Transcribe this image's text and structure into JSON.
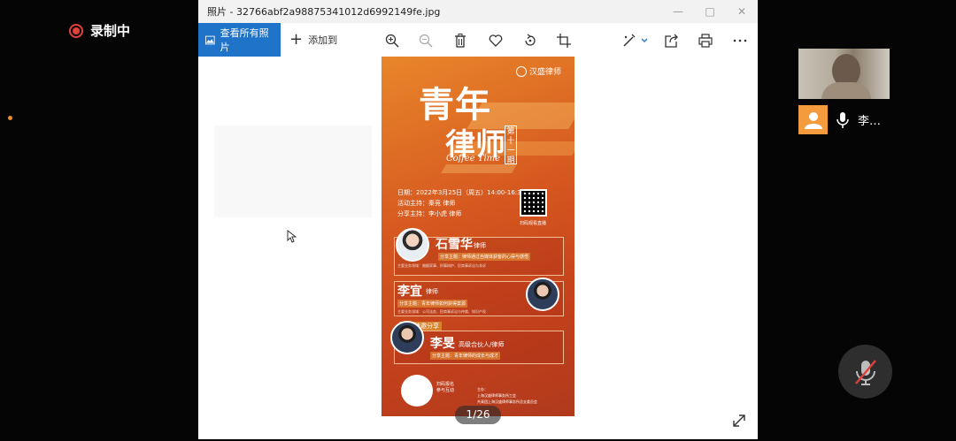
{
  "recording": {
    "label": "录制中",
    "color": "#e0413a"
  },
  "window": {
    "title": "照片 - 32766abf2a98875341012d6992149fe.jpg",
    "controls": [
      "minimize-icon",
      "maximize-icon",
      "close-icon"
    ]
  },
  "toolbar": {
    "view_all": "查看所有照片",
    "add_to": "添加到",
    "tools": [
      "zoom-in-icon",
      "zoom-out-icon",
      "delete-icon",
      "favorite-icon",
      "rotate-icon",
      "crop-icon",
      "edit-icon",
      "share-icon",
      "print-icon",
      "more-icon"
    ],
    "accent": "#1f74c9"
  },
  "poster": {
    "logo": "汉盛律师",
    "title_line1": "青年",
    "title_line2": "律师",
    "issue": "第十一期",
    "subtitle": "Coffee Time",
    "date": "日期：2022年3月25日（周五）14:00-16:30",
    "host": "活动主持：秦竞 律师",
    "sharer": "分享主持：李小虎 律师",
    "qr_caption": "扫码观看直播",
    "speakers": [
      {
        "name": "石雪华",
        "role": "律师",
        "topic": "分享主题：律师通过自媒体获客的心得与感悟",
        "desc": "主要业务领域：婚姻家事、刑事辩护、民商事诉讼与非诉"
      },
      {
        "name": "李宜",
        "role": "律师",
        "topic": "分享主题：青年律师如何获得案源",
        "desc": "主要业务领域：公司法务、民商事诉讼与仲裁、知识产权"
      },
      {
        "name": "李旻",
        "role": "高级合伙人/律师",
        "topic": "分享主题：青年律师的成长与成才",
        "tag": "嘉宾特邀分享"
      }
    ],
    "footer_qr_caption": "扫码报名 参与互动",
    "organizer_label": "主办：",
    "organizer": "上海汉盛律师事务所工会",
    "co_organizer": "共青团上海汉盛律师事务所总支委员会"
  },
  "viewer": {
    "counter": "1/26"
  },
  "participant": {
    "name": "李…",
    "avatar_color": "#f39b3d"
  }
}
